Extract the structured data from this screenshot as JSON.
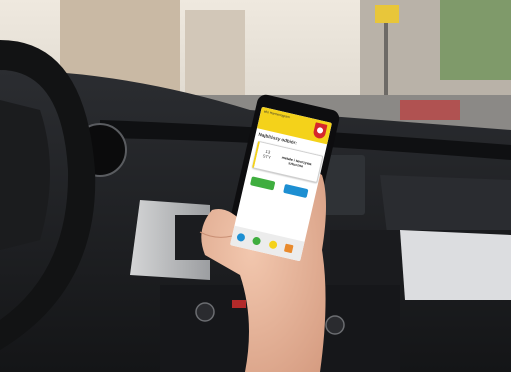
{
  "scene": {
    "colors": {
      "sky": "#e9e6df",
      "dashboard": "#1d1f22",
      "steering_wheel": "#121314",
      "phone": "#0d0d0f",
      "hand": "#e9b59a",
      "road": "#7b7a78",
      "app_yellow": "#f4d21a"
    }
  },
  "phone_app": {
    "app_name": "eko Harmonogram",
    "next_pickup_label": "Najbliższy odbiór:",
    "pickup": {
      "day_number": "13",
      "weekday": "STY",
      "waste_type": "metale i tworzywa sztuczne"
    },
    "button_left": "",
    "button_right": "",
    "nav_icons": [
      "menu-icon",
      "recycle-icon",
      "calendar-icon",
      "mail-icon"
    ]
  }
}
